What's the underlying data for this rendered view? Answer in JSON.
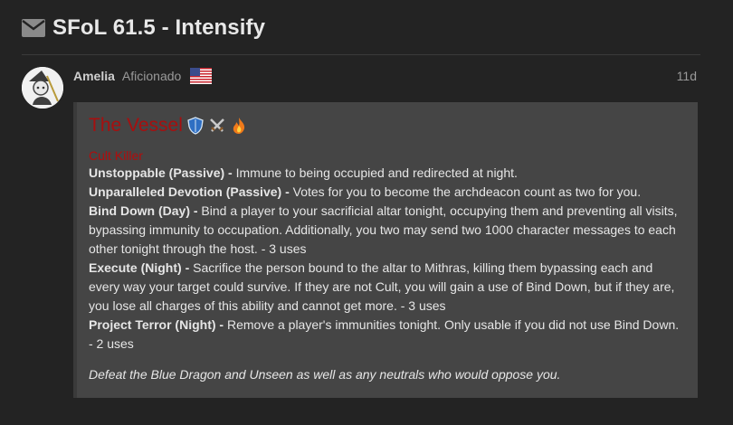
{
  "topic": {
    "title": "SFoL 61.5 - Intensify",
    "icon": "envelope-icon"
  },
  "post": {
    "username": "Amelia",
    "user_title": "Aficionado",
    "flag": "us-flag-icon",
    "age": "11d",
    "role_card": {
      "role_name": "The Vessel",
      "emojis": [
        "shield-emoji",
        "crossed-swords-emoji",
        "fire-emoji"
      ],
      "alignment": "Cult Killer",
      "abilities": [
        {
          "name": "Unstoppable (Passive) -",
          "text": " Immune to being occupied and redirected at night."
        },
        {
          "name": "Unparalleled Devotion (Passive) -",
          "text": " Votes for you to become the archdeacon count as two for you."
        },
        {
          "name": "Bind Down (Day) -",
          "text": " Bind a player to your sacrificial altar tonight, occupying them and preventing all visits, bypassing immunity to occupation. Additionally, you two may send two 1000 character messages to each other tonight through the host. - 3 uses"
        },
        {
          "name": "Execute (Night) -",
          "text": " Sacrifice the person bound to the altar to Mithras, killing them bypassing each and every way your target could survive. If they are not Cult, you will gain a use of Bind Down, but if they are, you lose all charges of this ability and cannot get more. - 3 uses"
        },
        {
          "name": "Project Terror (Night) -",
          "text": " Remove a player's immunities tonight. Only usable if you did not use Bind Down. - 2 uses"
        }
      ],
      "win_condition": "Defeat the Blue Dragon and Unseen as well as any neutrals who would oppose you."
    }
  },
  "colors": {
    "background": "#232323",
    "card": "#454545",
    "role_red": "#a70f0f"
  }
}
